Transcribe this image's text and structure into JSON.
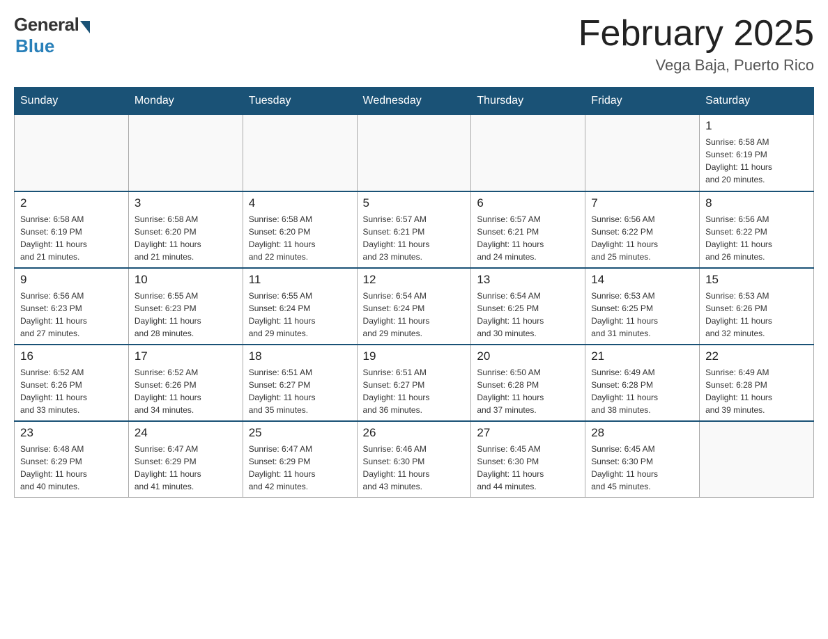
{
  "header": {
    "logo": {
      "general": "General",
      "blue": "Blue"
    },
    "title": "February 2025",
    "location": "Vega Baja, Puerto Rico"
  },
  "days_of_week": [
    "Sunday",
    "Monday",
    "Tuesday",
    "Wednesday",
    "Thursday",
    "Friday",
    "Saturday"
  ],
  "weeks": [
    [
      {
        "day": "",
        "info": ""
      },
      {
        "day": "",
        "info": ""
      },
      {
        "day": "",
        "info": ""
      },
      {
        "day": "",
        "info": ""
      },
      {
        "day": "",
        "info": ""
      },
      {
        "day": "",
        "info": ""
      },
      {
        "day": "1",
        "info": "Sunrise: 6:58 AM\nSunset: 6:19 PM\nDaylight: 11 hours\nand 20 minutes."
      }
    ],
    [
      {
        "day": "2",
        "info": "Sunrise: 6:58 AM\nSunset: 6:19 PM\nDaylight: 11 hours\nand 21 minutes."
      },
      {
        "day": "3",
        "info": "Sunrise: 6:58 AM\nSunset: 6:20 PM\nDaylight: 11 hours\nand 21 minutes."
      },
      {
        "day": "4",
        "info": "Sunrise: 6:58 AM\nSunset: 6:20 PM\nDaylight: 11 hours\nand 22 minutes."
      },
      {
        "day": "5",
        "info": "Sunrise: 6:57 AM\nSunset: 6:21 PM\nDaylight: 11 hours\nand 23 minutes."
      },
      {
        "day": "6",
        "info": "Sunrise: 6:57 AM\nSunset: 6:21 PM\nDaylight: 11 hours\nand 24 minutes."
      },
      {
        "day": "7",
        "info": "Sunrise: 6:56 AM\nSunset: 6:22 PM\nDaylight: 11 hours\nand 25 minutes."
      },
      {
        "day": "8",
        "info": "Sunrise: 6:56 AM\nSunset: 6:22 PM\nDaylight: 11 hours\nand 26 minutes."
      }
    ],
    [
      {
        "day": "9",
        "info": "Sunrise: 6:56 AM\nSunset: 6:23 PM\nDaylight: 11 hours\nand 27 minutes."
      },
      {
        "day": "10",
        "info": "Sunrise: 6:55 AM\nSunset: 6:23 PM\nDaylight: 11 hours\nand 28 minutes."
      },
      {
        "day": "11",
        "info": "Sunrise: 6:55 AM\nSunset: 6:24 PM\nDaylight: 11 hours\nand 29 minutes."
      },
      {
        "day": "12",
        "info": "Sunrise: 6:54 AM\nSunset: 6:24 PM\nDaylight: 11 hours\nand 29 minutes."
      },
      {
        "day": "13",
        "info": "Sunrise: 6:54 AM\nSunset: 6:25 PM\nDaylight: 11 hours\nand 30 minutes."
      },
      {
        "day": "14",
        "info": "Sunrise: 6:53 AM\nSunset: 6:25 PM\nDaylight: 11 hours\nand 31 minutes."
      },
      {
        "day": "15",
        "info": "Sunrise: 6:53 AM\nSunset: 6:26 PM\nDaylight: 11 hours\nand 32 minutes."
      }
    ],
    [
      {
        "day": "16",
        "info": "Sunrise: 6:52 AM\nSunset: 6:26 PM\nDaylight: 11 hours\nand 33 minutes."
      },
      {
        "day": "17",
        "info": "Sunrise: 6:52 AM\nSunset: 6:26 PM\nDaylight: 11 hours\nand 34 minutes."
      },
      {
        "day": "18",
        "info": "Sunrise: 6:51 AM\nSunset: 6:27 PM\nDaylight: 11 hours\nand 35 minutes."
      },
      {
        "day": "19",
        "info": "Sunrise: 6:51 AM\nSunset: 6:27 PM\nDaylight: 11 hours\nand 36 minutes."
      },
      {
        "day": "20",
        "info": "Sunrise: 6:50 AM\nSunset: 6:28 PM\nDaylight: 11 hours\nand 37 minutes."
      },
      {
        "day": "21",
        "info": "Sunrise: 6:49 AM\nSunset: 6:28 PM\nDaylight: 11 hours\nand 38 minutes."
      },
      {
        "day": "22",
        "info": "Sunrise: 6:49 AM\nSunset: 6:28 PM\nDaylight: 11 hours\nand 39 minutes."
      }
    ],
    [
      {
        "day": "23",
        "info": "Sunrise: 6:48 AM\nSunset: 6:29 PM\nDaylight: 11 hours\nand 40 minutes."
      },
      {
        "day": "24",
        "info": "Sunrise: 6:47 AM\nSunset: 6:29 PM\nDaylight: 11 hours\nand 41 minutes."
      },
      {
        "day": "25",
        "info": "Sunrise: 6:47 AM\nSunset: 6:29 PM\nDaylight: 11 hours\nand 42 minutes."
      },
      {
        "day": "26",
        "info": "Sunrise: 6:46 AM\nSunset: 6:30 PM\nDaylight: 11 hours\nand 43 minutes."
      },
      {
        "day": "27",
        "info": "Sunrise: 6:45 AM\nSunset: 6:30 PM\nDaylight: 11 hours\nand 44 minutes."
      },
      {
        "day": "28",
        "info": "Sunrise: 6:45 AM\nSunset: 6:30 PM\nDaylight: 11 hours\nand 45 minutes."
      },
      {
        "day": "",
        "info": ""
      }
    ]
  ]
}
